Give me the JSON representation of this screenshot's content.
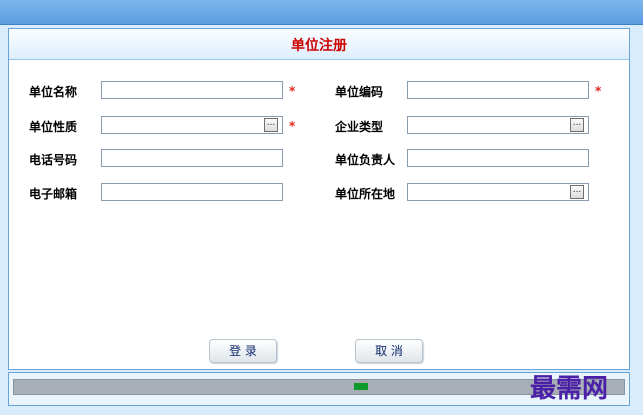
{
  "form": {
    "title": "单位注册",
    "required_mark": "*",
    "fields": {
      "unit_name": {
        "label": "单位名称",
        "value": ""
      },
      "unit_code": {
        "label": "单位编码",
        "value": ""
      },
      "unit_nature": {
        "label": "单位性质",
        "value": "",
        "button": "..."
      },
      "enterprise_type": {
        "label": "企业类型",
        "value": "",
        "button": "..."
      },
      "phone": {
        "label": "电话号码",
        "value": ""
      },
      "unit_leader": {
        "label": "单位负责人",
        "value": ""
      },
      "email": {
        "label": "电子邮箱",
        "value": ""
      },
      "unit_location": {
        "label": "单位所在地",
        "value": "",
        "button": "..."
      }
    },
    "buttons": {
      "login": "登 录",
      "cancel": "取 消"
    }
  },
  "status": {
    "progress_visible": true
  },
  "watermark": "最需网"
}
